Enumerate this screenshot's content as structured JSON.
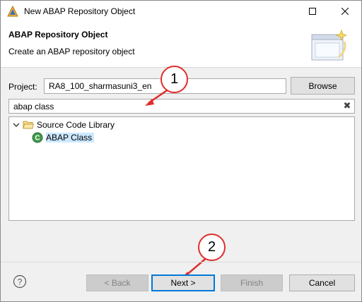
{
  "window": {
    "title": "New ABAP Repository Object",
    "app_icon": "eclipse-abap-icon",
    "maximize_icon": "maximize-icon",
    "close_icon": "close-icon"
  },
  "banner": {
    "title": "ABAP Repository Object",
    "subtitle": "Create an ABAP repository object",
    "icon": "wizard-banner-icon"
  },
  "project": {
    "label": "Project:",
    "value": "RA8_100_sharmasuni3_en",
    "browse_label": "Browse"
  },
  "filter": {
    "value": "abap class",
    "clear_icon": "clear-icon"
  },
  "tree": {
    "folder": {
      "label": "Source Code Library",
      "icon": "folder-open-icon",
      "expanded": true
    },
    "item": {
      "label": "ABAP Class",
      "icon": "abap-class-icon",
      "selected": true
    }
  },
  "callouts": [
    {
      "number": "1"
    },
    {
      "number": "2"
    }
  ],
  "footer": {
    "help_icon": "help-icon",
    "back_label": "< Back",
    "next_label": "Next >",
    "finish_label": "Finish",
    "cancel_label": "Cancel"
  },
  "colors": {
    "callout": "#e02c2c",
    "selection": "#cce8ff",
    "default_button_border": "#0078d7"
  }
}
